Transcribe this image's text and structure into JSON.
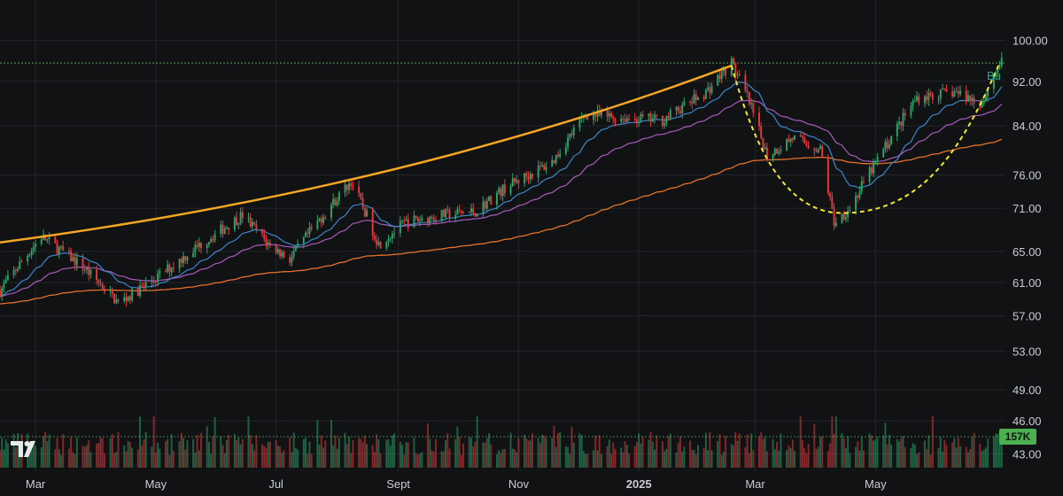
{
  "chart_data": {
    "type": "candlestick",
    "y_axis": {
      "scale": "log",
      "ylim": [
        41.5,
        104
      ],
      "ticks": [
        "100.00",
        "92.00",
        "84.00",
        "76.00",
        "71.00",
        "65.00",
        "61.00",
        "57.00",
        "53.00",
        "49.00",
        "46.00",
        "43.00"
      ]
    },
    "x_axis": {
      "labels": [
        "Mar",
        "May",
        "Jul",
        "Sept",
        "Nov",
        "2025",
        "Mar",
        "May"
      ],
      "year_label": "2025",
      "range": [
        "2024-02-12",
        "2025-07-05"
      ]
    },
    "grid": true,
    "price_path": [
      [
        "2024-02-12",
        60.0
      ],
      [
        "2024-03-04",
        67.0
      ],
      [
        "2024-03-25",
        63.0
      ],
      [
        "2024-04-12",
        58.5
      ],
      [
        "2024-05-01",
        61.5
      ],
      [
        "2024-05-24",
        66.0
      ],
      [
        "2024-06-14",
        70.0
      ],
      [
        "2024-06-27",
        66.0
      ],
      [
        "2024-07-08",
        64.0
      ],
      [
        "2024-08-01",
        72.5
      ],
      [
        "2024-08-08",
        75.0
      ],
      [
        "2024-08-22",
        66.0
      ],
      [
        "2024-09-05",
        69.0
      ],
      [
        "2024-09-23",
        70.0
      ],
      [
        "2024-10-10",
        70.5
      ],
      [
        "2024-10-25",
        74.0
      ],
      [
        "2024-11-18",
        78.0
      ],
      [
        "2024-12-05",
        86.0
      ],
      [
        "2024-12-19",
        85.5
      ],
      [
        "2025-01-13",
        85.0
      ],
      [
        "2025-02-04",
        90.0
      ],
      [
        "2025-02-17",
        95.5
      ],
      [
        "2025-02-25",
        89.0
      ],
      [
        "2025-03-07",
        79.0
      ],
      [
        "2025-03-20",
        82.0
      ],
      [
        "2025-04-03",
        80.0
      ],
      [
        "2025-04-10",
        69.0
      ],
      [
        "2025-04-18",
        71.0
      ],
      [
        "2025-05-05",
        80.0
      ],
      [
        "2025-05-22",
        89.0
      ],
      [
        "2025-06-10",
        90.0
      ],
      [
        "2025-06-24",
        88.0
      ],
      [
        "2025-07-03",
        95.5
      ]
    ],
    "series": [
      {
        "type": "ema",
        "period": 20,
        "color": "#3d8ed6"
      },
      {
        "type": "ema",
        "period": 50,
        "color": "#b25fc4"
      },
      {
        "type": "ema",
        "period": 200,
        "color": "#f0762a"
      }
    ],
    "trendline": {
      "points": [
        [
          "2024-02-12",
          66.2
        ],
        [
          "2025-02-17",
          95.0
        ]
      ],
      "color": "#f5a623"
    },
    "cup_curve": {
      "points": [
        [
          "2025-02-17",
          95.0
        ],
        [
          "2025-04-14",
          70.3
        ],
        [
          "2025-07-03",
          95.5
        ]
      ],
      "color": "#f2ea2c"
    },
    "reference_line": {
      "value": 95.5,
      "color": "#5fae5f"
    },
    "volume": {
      "last": "157K",
      "bars": 360
    },
    "colors": {
      "up": "#2fa36a",
      "down": "#e8383d",
      "background": "#111214",
      "grid": "#23252a"
    }
  },
  "overlay": {
    "partial_label": "Bu",
    "volume_badge": "157K",
    "logo_text": "TV"
  }
}
